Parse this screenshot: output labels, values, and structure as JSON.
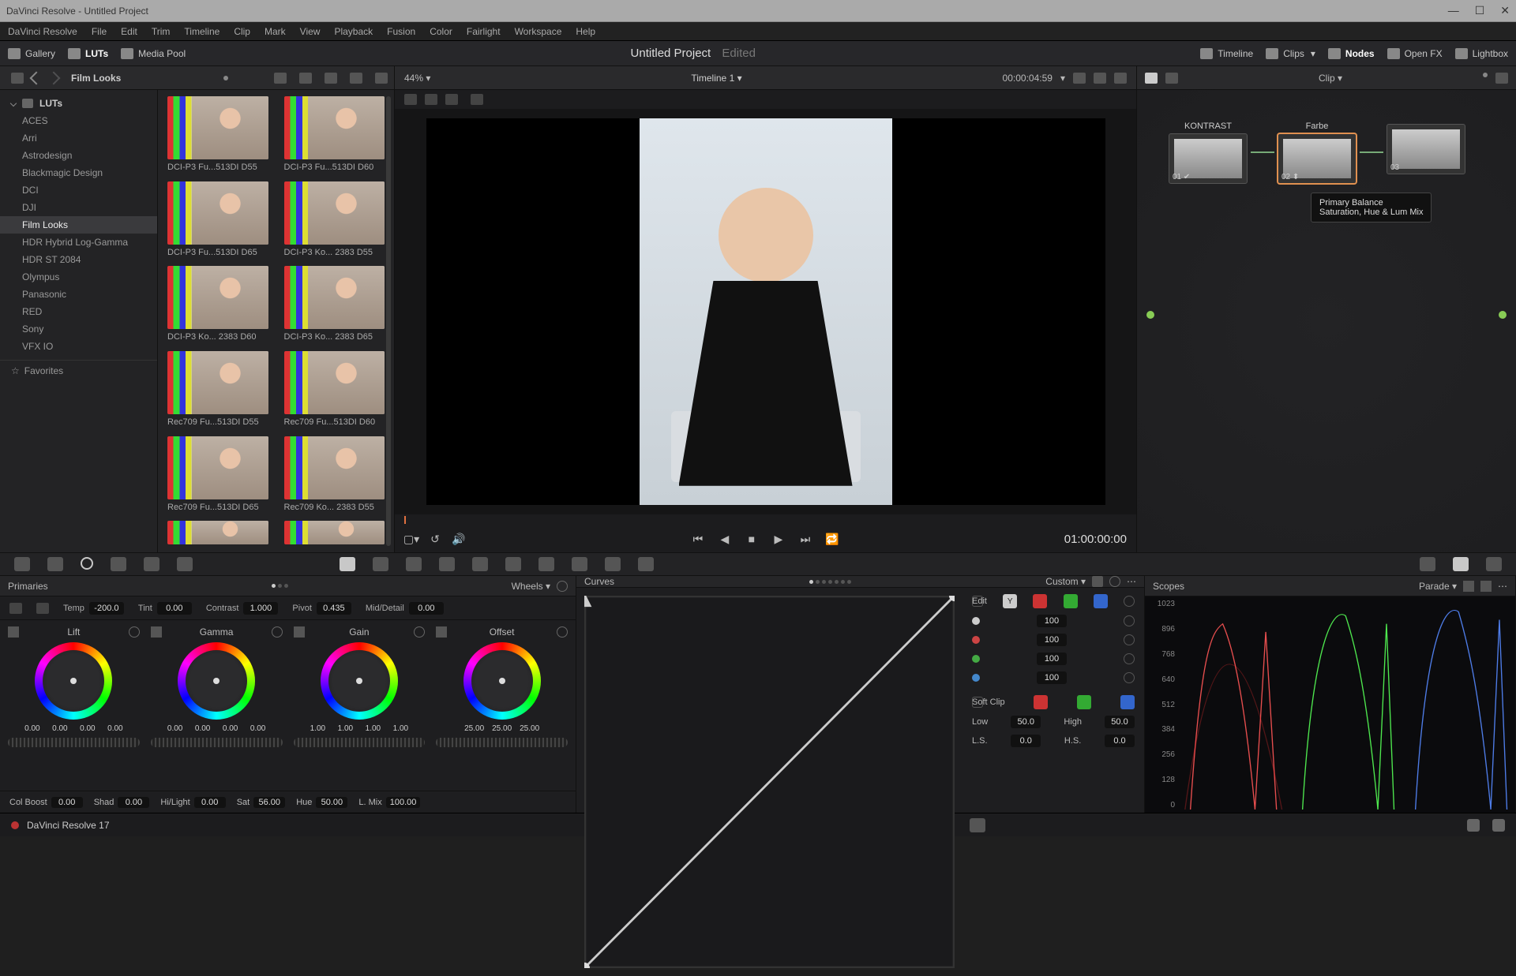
{
  "window_title": "DaVinci Resolve - Untitled Project",
  "menu": [
    "DaVinci Resolve",
    "File",
    "Edit",
    "Trim",
    "Timeline",
    "Clip",
    "Mark",
    "View",
    "Playback",
    "Fusion",
    "Color",
    "Fairlight",
    "Workspace",
    "Help"
  ],
  "toolbar": {
    "gallery": "Gallery",
    "luts": "LUTs",
    "mediapool": "Media Pool",
    "project": "Untitled Project",
    "edited": "Edited",
    "timeline": "Timeline",
    "clips": "Clips",
    "nodes": "Nodes",
    "openfx": "Open FX",
    "lightbox": "Lightbox"
  },
  "left": {
    "crumb": "Film Looks",
    "zoom": "44%",
    "root": "LUTs",
    "items": [
      "ACES",
      "Arri",
      "Astrodesign",
      "Blackmagic Design",
      "DCI",
      "DJI",
      "Film Looks",
      "HDR Hybrid Log-Gamma",
      "HDR ST 2084",
      "Olympus",
      "Panasonic",
      "RED",
      "Sony",
      "VFX IO"
    ],
    "selected": "Film Looks",
    "favorites": "Favorites",
    "thumbs": [
      "DCI-P3 Fu...513DI D55",
      "DCI-P3 Fu...513DI D60",
      "DCI-P3 Fu...513DI D65",
      "DCI-P3 Ko... 2383 D55",
      "DCI-P3 Ko... 2383 D60",
      "DCI-P3 Ko... 2383 D65",
      "Rec709 Fu...513DI D55",
      "Rec709 Fu...513DI D60",
      "Rec709 Fu...513DI D65",
      "Rec709 Ko... 2383 D55"
    ]
  },
  "viewer": {
    "timeline_name": "Timeline 1",
    "dur": "00:00:04:59",
    "tc": "01:00:00:00"
  },
  "nodes": {
    "mode": "Clip",
    "n1": {
      "label": "KONTRAST",
      "num": "01"
    },
    "n2": {
      "label": "Farbe",
      "num": "02"
    },
    "n3": {
      "label": "",
      "num": "03"
    },
    "tooltip_l1": "Primary Balance",
    "tooltip_l2": "Saturation, Hue & Lum Mix"
  },
  "primaries": {
    "title": "Primaries",
    "wheels_label": "Wheels",
    "temp": {
      "lbl": "Temp",
      "val": "-200.0"
    },
    "tint": {
      "lbl": "Tint",
      "val": "0.00"
    },
    "contrast": {
      "lbl": "Contrast",
      "val": "1.000"
    },
    "pivot": {
      "lbl": "Pivot",
      "val": "0.435"
    },
    "middetail": {
      "lbl": "Mid/Detail",
      "val": "0.00"
    },
    "wheels": [
      {
        "name": "Lift",
        "vals": [
          "0.00",
          "0.00",
          "0.00",
          "0.00"
        ]
      },
      {
        "name": "Gamma",
        "vals": [
          "0.00",
          "0.00",
          "0.00",
          "0.00"
        ]
      },
      {
        "name": "Gain",
        "vals": [
          "1.00",
          "1.00",
          "1.00",
          "1.00"
        ]
      },
      {
        "name": "Offset",
        "vals": [
          "25.00",
          "25.00",
          "25.00"
        ]
      }
    ],
    "bottom": {
      "colboost": {
        "lbl": "Col Boost",
        "val": "0.00"
      },
      "shad": {
        "lbl": "Shad",
        "val": "0.00"
      },
      "hilight": {
        "lbl": "Hi/Light",
        "val": "0.00"
      },
      "sat": {
        "lbl": "Sat",
        "val": "56.00"
      },
      "hue": {
        "lbl": "Hue",
        "val": "50.00"
      },
      "lmix": {
        "lbl": "L. Mix",
        "val": "100.00"
      }
    }
  },
  "curves": {
    "title": "Curves",
    "mode": "Custom",
    "edit": "Edit",
    "y": "Y",
    "vals": [
      "100",
      "100",
      "100",
      "100"
    ],
    "softclip": "Soft Clip",
    "low": {
      "lbl": "Low",
      "val": "50.0"
    },
    "high": {
      "lbl": "High",
      "val": "50.0"
    },
    "ls": {
      "lbl": "L.S.",
      "val": "0.0"
    },
    "hs": {
      "lbl": "H.S.",
      "val": "0.0"
    }
  },
  "scopes": {
    "title": "Scopes",
    "mode": "Parade",
    "ticks": [
      "1023",
      "896",
      "768",
      "640",
      "512",
      "384",
      "256",
      "128",
      "0"
    ]
  },
  "footer": {
    "app": "DaVinci Resolve 17"
  }
}
